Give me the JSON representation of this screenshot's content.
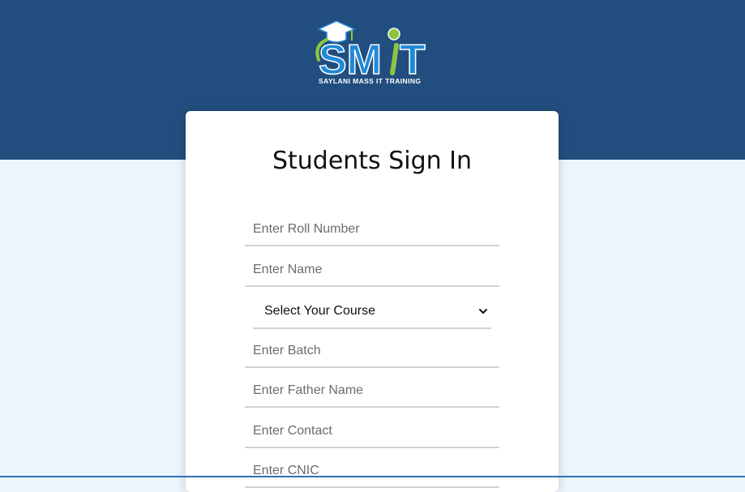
{
  "header": {
    "logo_text": "SMIT",
    "logo_tagline": "SAYLANI MASS IT TRAINING"
  },
  "form": {
    "title": "Students Sign In",
    "fields": {
      "roll_number": {
        "placeholder": "Enter Roll Number",
        "value": ""
      },
      "name": {
        "placeholder": "Enter Name",
        "value": ""
      },
      "course": {
        "selected": "Select Your Course"
      },
      "batch": {
        "placeholder": "Enter Batch",
        "value": ""
      },
      "father_name": {
        "placeholder": "Enter Father Name",
        "value": ""
      },
      "contact": {
        "placeholder": "Enter Contact",
        "value": ""
      },
      "cnic": {
        "placeholder": "Enter CNIC",
        "value": ""
      }
    }
  },
  "colors": {
    "header_bg": "#224e7f",
    "page_bg": "#eef6fd",
    "card_bg": "#ffffff",
    "logo_blue": "#1f8ad8",
    "logo_green": "#8cc63f"
  }
}
